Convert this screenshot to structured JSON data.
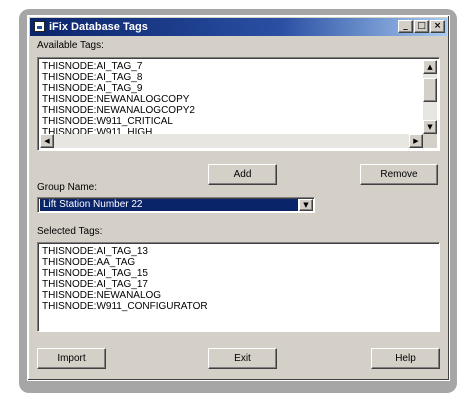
{
  "window": {
    "title": "iFix Database Tags",
    "controls": {
      "minimize": "_",
      "maximize": "□",
      "close": "×"
    }
  },
  "available": {
    "label": "Available Tags:",
    "items": [
      "THISNODE:AI_TAG_7",
      "THISNODE:AI_TAG_8",
      "THISNODE:AI_TAG_9",
      "THISNODE:NEWANALOGCOPY",
      "THISNODE:NEWANALOGCOPY2",
      "THISNODE:W911_CRITICAL",
      "THISNODE:W911_HIGH"
    ]
  },
  "buttons": {
    "add": "Add",
    "remove": "Remove",
    "import": "Import",
    "exit": "Exit",
    "help": "Help"
  },
  "group": {
    "label": "Group Name:",
    "value": "Lift Station Number 22"
  },
  "selected": {
    "label": "Selected Tags:",
    "items": [
      "THISNODE:AI_TAG_13",
      "THISNODE:AA_TAG",
      "THISNODE:AI_TAG_15",
      "THISNODE:AI_TAG_17",
      "THISNODE:NEWANALOG",
      "THISNODE:W911_CONFIGURATOR"
    ]
  },
  "colors": {
    "titlebar": "#0a246a",
    "face": "#d4d0c8",
    "selection": "#0a246a"
  },
  "icons": {
    "app": "app-icon",
    "up": "▲",
    "down": "▼",
    "left": "◀",
    "right": "▶",
    "dropdown": "▼"
  }
}
